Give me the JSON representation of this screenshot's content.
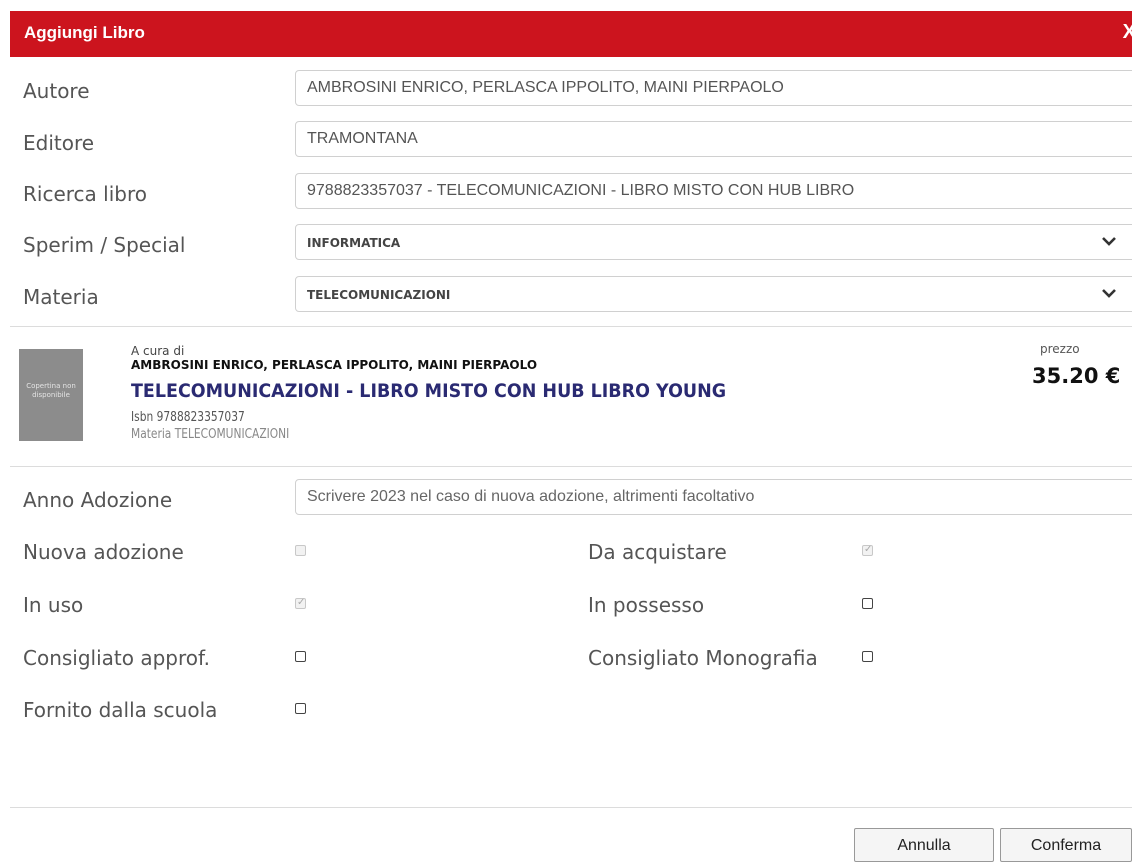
{
  "dialog": {
    "title": "Aggiungi Libro",
    "close_glyph": "X"
  },
  "form": {
    "autore": {
      "label": "Autore",
      "value": "AMBROSINI ENRICO, PERLASCA IPPOLITO, MAINI PIERPAOLO"
    },
    "editore": {
      "label": "Editore",
      "value": "TRAMONTANA"
    },
    "ricerca": {
      "label": "Ricerca libro",
      "value": "9788823357037 - TELECOMUNICAZIONI - LIBRO MISTO CON HUB LIBRO"
    },
    "sperim": {
      "label": "Sperim / Special",
      "value": "INFORMATICA"
    },
    "materia": {
      "label": "Materia",
      "value": "TELECOMUNICAZIONI"
    }
  },
  "book": {
    "cover_text": "Copertina non disponibile",
    "curated_label": "A cura di",
    "authors": "AMBROSINI ENRICO, PERLASCA IPPOLITO, MAINI PIERPAOLO",
    "title": "TELECOMUNICAZIONI - LIBRO MISTO CON HUB LIBRO YOUNG",
    "isbn": "Isbn 9788823357037",
    "materia": "Materia TELECOMUNICAZIONI",
    "price_label": "prezzo",
    "price": "35.20 €"
  },
  "adoption": {
    "anno_label": "Anno Adozione",
    "anno_placeholder": "Scrivere 2023 nel caso di nuova adozione, altrimenti facoltativo",
    "checks": {
      "nuova": {
        "label": "Nuova adozione",
        "checked": false,
        "disabled": true
      },
      "acquistare": {
        "label": "Da acquistare",
        "checked": true,
        "disabled": true
      },
      "in_uso": {
        "label": "In uso",
        "checked": true,
        "disabled": true
      },
      "possesso": {
        "label": "In possesso",
        "checked": false,
        "disabled": false
      },
      "approf": {
        "label": "Consigliato approf.",
        "checked": false,
        "disabled": false
      },
      "monografia": {
        "label": "Consigliato Monografia",
        "checked": false,
        "disabled": false
      },
      "fornito": {
        "label": "Fornito dalla scuola",
        "checked": false,
        "disabled": false
      }
    }
  },
  "buttons": {
    "cancel": "Annulla",
    "confirm": "Conferma"
  },
  "colors": {
    "header": "#cc141e",
    "book_title": "#2a2a72"
  }
}
